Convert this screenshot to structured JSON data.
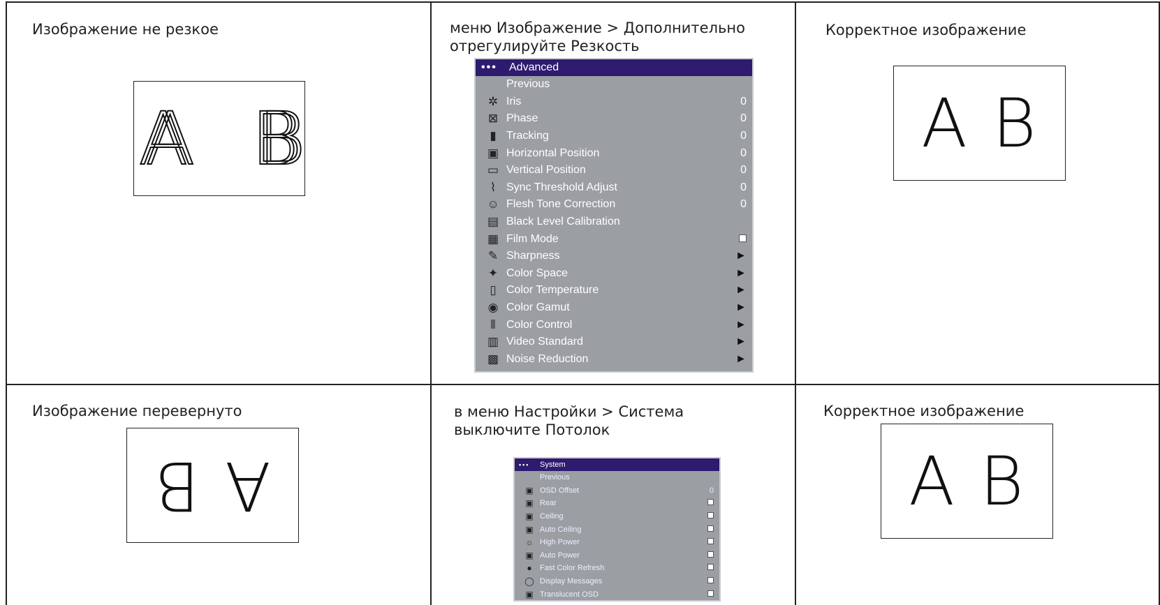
{
  "row1": {
    "problem": "Изображение не резкое",
    "solution": "меню Изображение > Дополнительно\nотрегулируйте Резкость",
    "result": "Корректное изображение"
  },
  "row2": {
    "problem": "Изображение перевернуто",
    "solution": "в меню Настройки > Система\nвыключите Потолок",
    "result": "Корректное изображение"
  },
  "letters": {
    "a": "A",
    "b": "B"
  },
  "advanced_menu": {
    "title": "Advanced",
    "dots": "•••",
    "items": [
      {
        "label": "Previous",
        "value": "",
        "icon": "none",
        "kind": "text"
      },
      {
        "label": "Iris",
        "value": "0",
        "icon": "iris-icon",
        "kind": "value"
      },
      {
        "label": "Phase",
        "value": "0",
        "icon": "phase-icon",
        "kind": "value"
      },
      {
        "label": "Tracking",
        "value": "0",
        "icon": "tracking-icon",
        "kind": "value"
      },
      {
        "label": "Horizontal Position",
        "value": "0",
        "icon": "horizontal-position-icon",
        "kind": "value"
      },
      {
        "label": "Vertical Position",
        "value": "0",
        "icon": "vertical-position-icon",
        "kind": "value"
      },
      {
        "label": "Sync Threshold Adjust",
        "value": "0",
        "icon": "sync-threshold-icon",
        "kind": "value"
      },
      {
        "label": "Flesh Tone Correction",
        "value": "0",
        "icon": "flesh-tone-icon",
        "kind": "value"
      },
      {
        "label": "Black Level Calibration",
        "value": "",
        "icon": "black-level-icon",
        "kind": "text"
      },
      {
        "label": "Film Mode",
        "value": "",
        "icon": "film-mode-icon",
        "kind": "check"
      },
      {
        "label": "Sharpness",
        "value": "►",
        "icon": "sharpness-icon",
        "kind": "arrow"
      },
      {
        "label": "Color Space",
        "value": "►",
        "icon": "color-space-icon",
        "kind": "arrow"
      },
      {
        "label": "Color Temperature",
        "value": "►",
        "icon": "color-temperature-icon",
        "kind": "arrow"
      },
      {
        "label": "Color Gamut",
        "value": "►",
        "icon": "color-gamut-icon",
        "kind": "arrow"
      },
      {
        "label": "Color Control",
        "value": "►",
        "icon": "color-control-icon",
        "kind": "arrow"
      },
      {
        "label": "Video Standard",
        "value": "►",
        "icon": "video-standard-icon",
        "kind": "arrow"
      },
      {
        "label": "Noise Reduction",
        "value": "►",
        "icon": "noise-reduction-icon",
        "kind": "arrow"
      }
    ]
  },
  "system_menu": {
    "title": "System",
    "dots": "•••",
    "items": [
      {
        "label": "Previous",
        "value": "",
        "icon": "none",
        "kind": "text"
      },
      {
        "label": "OSD Offset",
        "value": "0",
        "icon": "osd-offset-icon",
        "kind": "value"
      },
      {
        "label": "Rear",
        "value": "",
        "icon": "rear-icon",
        "kind": "check"
      },
      {
        "label": "Ceiling",
        "value": "",
        "icon": "ceiling-icon",
        "kind": "check"
      },
      {
        "label": "Auto Ceiling",
        "value": "",
        "icon": "auto-ceiling-icon",
        "kind": "check"
      },
      {
        "label": "High Power",
        "value": "",
        "icon": "high-power-icon",
        "kind": "check"
      },
      {
        "label": "Auto Power",
        "value": "",
        "icon": "auto-power-icon",
        "kind": "check"
      },
      {
        "label": "Fast Color Refresh",
        "value": "",
        "icon": "fast-color-refresh-icon",
        "kind": "check"
      },
      {
        "label": "Display Messages",
        "value": "",
        "icon": "display-messages-icon",
        "kind": "check"
      },
      {
        "label": "Translucent OSD",
        "value": "",
        "icon": "translucent-osd-icon",
        "kind": "check"
      }
    ]
  },
  "colors": {
    "menu_bg": "#9b9ea3",
    "menu_title_bg": "#2e1a6e",
    "grid": "#222222"
  }
}
